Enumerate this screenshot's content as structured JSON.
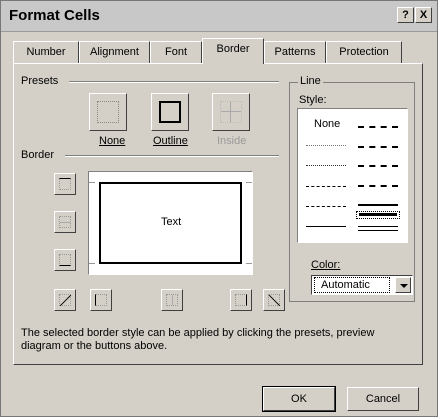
{
  "window": {
    "title": "Format Cells",
    "help_glyph": "?",
    "close_glyph": "X"
  },
  "tabs": [
    {
      "label": "Number"
    },
    {
      "label": "Alignment"
    },
    {
      "label": "Font"
    },
    {
      "label": "Border",
      "active": true
    },
    {
      "label": "Patterns"
    },
    {
      "label": "Protection"
    }
  ],
  "presets": {
    "heading": "Presets",
    "items": [
      {
        "label": "None",
        "enabled": true
      },
      {
        "label": "Outline",
        "enabled": true
      },
      {
        "label": "Inside",
        "enabled": false
      }
    ]
  },
  "border": {
    "heading": "Border",
    "preview_text": "Text"
  },
  "line": {
    "heading": "Line",
    "style_label": "Style:",
    "none_label": "None",
    "color_label": "Color:",
    "color_value": "Automatic"
  },
  "help_text": "The selected border style can be applied by clicking the presets, preview diagram or the buttons above.",
  "buttons": {
    "ok": "OK",
    "cancel": "Cancel"
  }
}
